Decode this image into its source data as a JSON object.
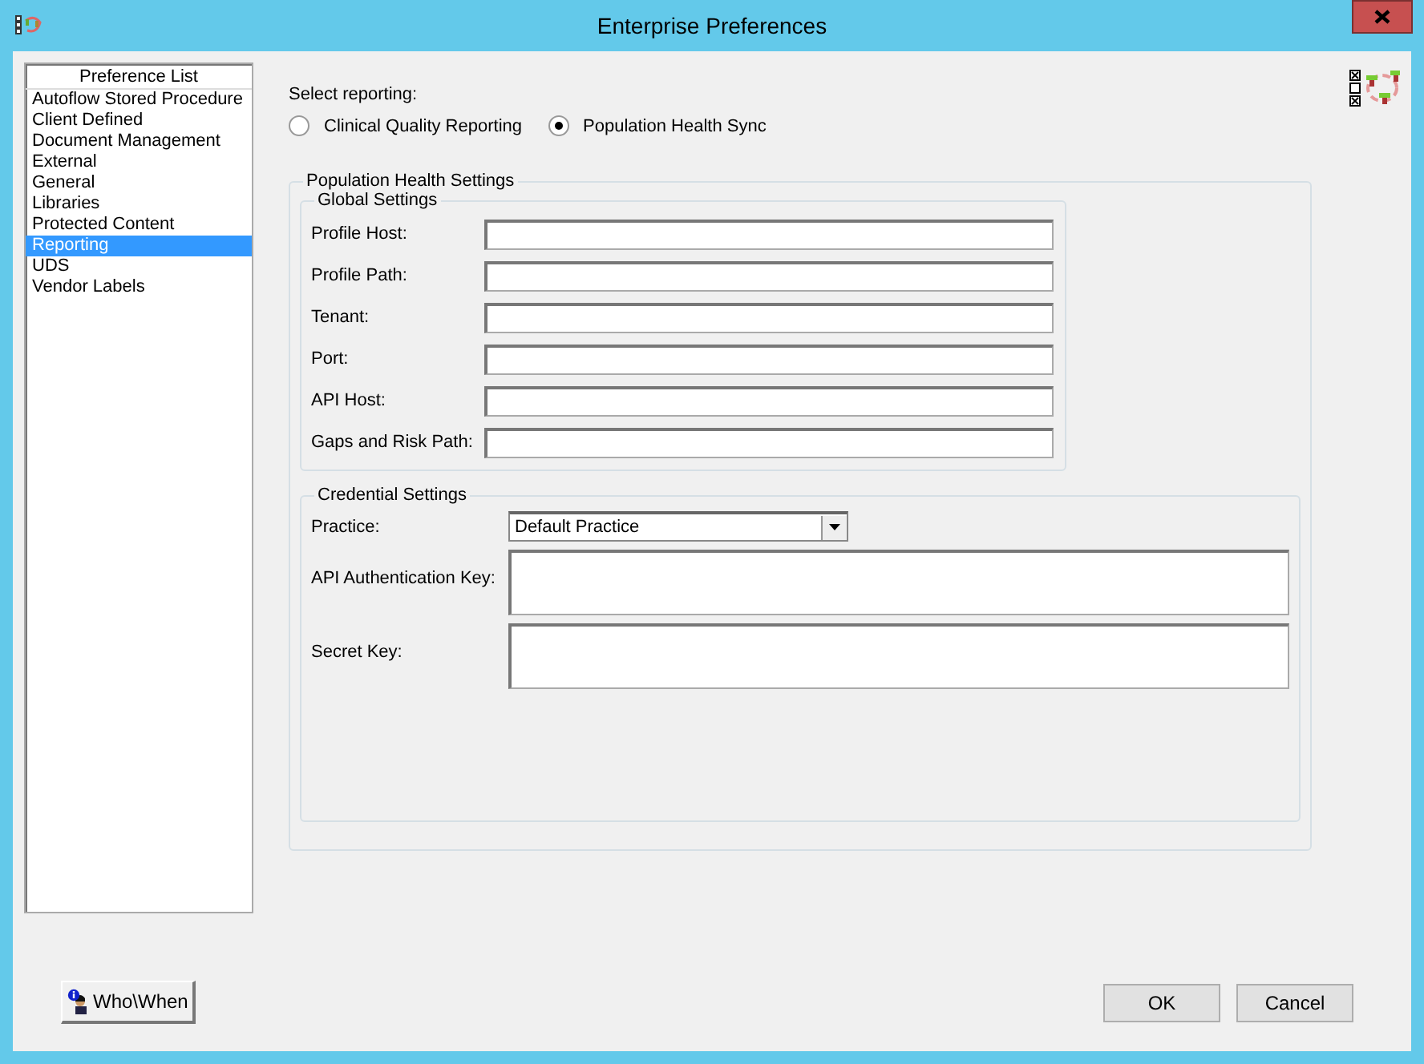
{
  "window": {
    "title": "Enterprise Preferences"
  },
  "preference_list": {
    "header": "Preference List",
    "items": [
      {
        "label": "Autoflow Stored Procedure",
        "selected": false
      },
      {
        "label": "Client Defined",
        "selected": false
      },
      {
        "label": "Document Management",
        "selected": false
      },
      {
        "label": "External",
        "selected": false
      },
      {
        "label": "General",
        "selected": false
      },
      {
        "label": "Libraries",
        "selected": false
      },
      {
        "label": "Protected Content",
        "selected": false
      },
      {
        "label": "Reporting",
        "selected": true
      },
      {
        "label": "UDS",
        "selected": false
      },
      {
        "label": "Vendor Labels",
        "selected": false
      }
    ]
  },
  "reporting": {
    "label": "Select reporting:",
    "options": [
      {
        "label": "Clinical Quality Reporting",
        "selected": false
      },
      {
        "label": "Population Health Sync",
        "selected": true
      }
    ]
  },
  "population_health_settings": {
    "title": "Population Health Settings",
    "global_settings": {
      "title": "Global Settings",
      "fields": [
        {
          "label": "Profile Host:"
        },
        {
          "label": "Profile Path:"
        },
        {
          "label": "Tenant:"
        },
        {
          "label": "Port:"
        },
        {
          "label": "API Host:"
        },
        {
          "label": "Gaps and Risk Path:"
        }
      ]
    },
    "credential_settings": {
      "title": "Credential Settings",
      "practice": {
        "label": "Practice:",
        "value": "Default Practice"
      },
      "api_key": {
        "label": "API Authentication Key:"
      },
      "secret_key": {
        "label": "Secret Key:"
      }
    }
  },
  "buttons": {
    "who_when": "Who\\When",
    "ok": "OK",
    "cancel": "Cancel"
  }
}
